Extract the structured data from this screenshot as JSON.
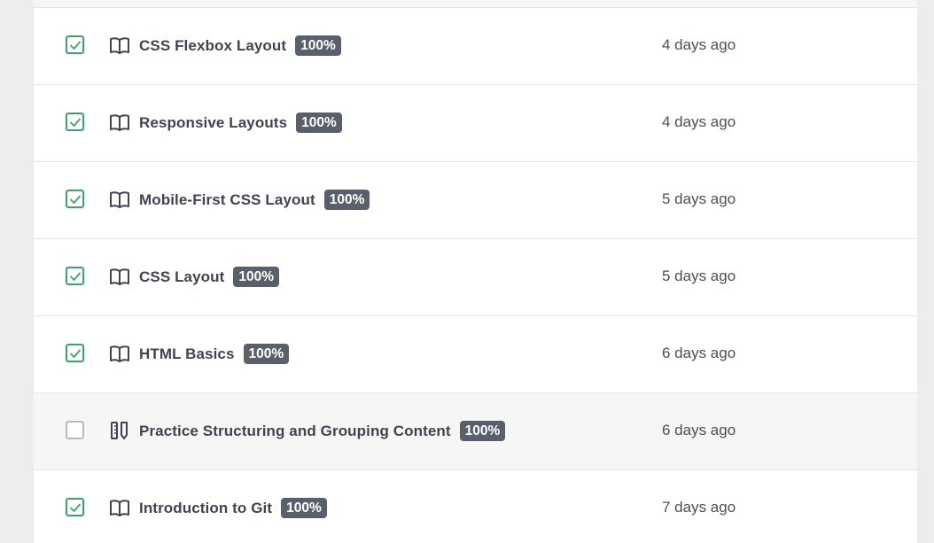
{
  "items": [
    {
      "title": "CSS Flexbox Layout",
      "progress": "100%",
      "time": "4 days ago",
      "completed": true,
      "type": "book-icon"
    },
    {
      "title": "Responsive Layouts",
      "progress": "100%",
      "time": "4 days ago",
      "completed": true,
      "type": "book-icon"
    },
    {
      "title": "Mobile-First CSS Layout",
      "progress": "100%",
      "time": "5 days ago",
      "completed": true,
      "type": "book-icon"
    },
    {
      "title": "CSS Layout",
      "progress": "100%",
      "time": "5 days ago",
      "completed": true,
      "type": "book-icon"
    },
    {
      "title": "HTML Basics",
      "progress": "100%",
      "time": "6 days ago",
      "completed": true,
      "type": "book-icon"
    },
    {
      "title": "Practice Structuring and Grouping Content",
      "progress": "100%",
      "time": "6 days ago",
      "completed": false,
      "type": "practice-icon"
    },
    {
      "title": "Introduction to Git",
      "progress": "100%",
      "time": "7 days ago",
      "completed": true,
      "type": "book-icon"
    }
  ],
  "colors": {
    "check_green": "#3aa66a",
    "badge_bg": "#59606b",
    "title_text": "#3f4450"
  }
}
